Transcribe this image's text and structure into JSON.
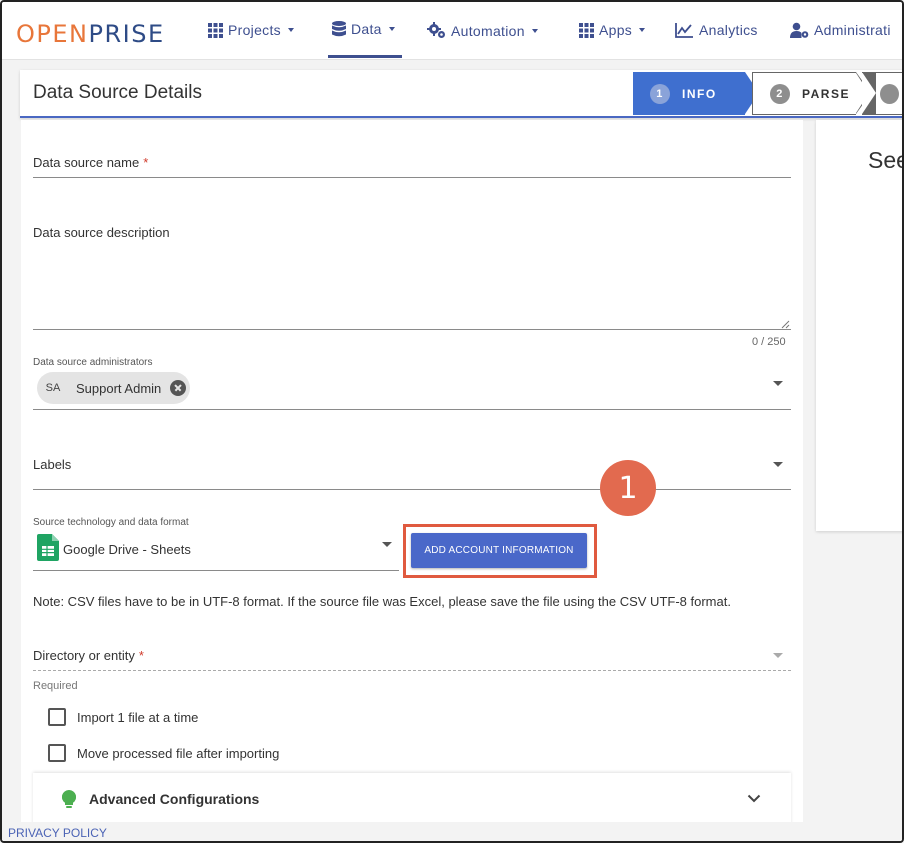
{
  "logo": {
    "part1": "OPEN",
    "part2": "PRISE"
  },
  "nav": {
    "projects": "Projects",
    "data": "Data",
    "automation": "Automation",
    "apps": "Apps",
    "analytics": "Analytics",
    "administration": "Administrati"
  },
  "header": {
    "title": "Data Source Details",
    "steps": [
      {
        "num": "1",
        "label": "INFO"
      },
      {
        "num": "2",
        "label": "PARSE"
      }
    ]
  },
  "form": {
    "name_label": "Data source name",
    "required_mark": "*",
    "description_label": "Data source description",
    "char_counter": "0 / 250",
    "admins_label": "Data source administrators",
    "admin_chip": {
      "initials": "SA",
      "name": "Support Admin"
    },
    "labels_label": "Labels",
    "source_tech_label": "Source technology and data format",
    "source_tech_value": "Google Drive - Sheets",
    "add_account_button": "ADD ACCOUNT INFORMATION",
    "note": "Note: CSV files have to be in UTF-8 format. If the source file was Excel, please save the file using the CSV UTF-8 format.",
    "directory_label": "Directory or entity",
    "directory_hint": "Required",
    "checkbox_import": "Import 1 file at a time",
    "checkbox_move": "Move processed file after importing",
    "advanced_title": "Advanced Configurations"
  },
  "annotation_badge": "1",
  "side_panel": {
    "title": "See"
  },
  "footer": {
    "privacy": "PRIVACY POLICY"
  },
  "colors": {
    "accent": "#3f6fcf",
    "button": "#4a68c9",
    "annotation": "#e26a4f",
    "required": "#d03a2b",
    "bulb": "#4caf50"
  }
}
